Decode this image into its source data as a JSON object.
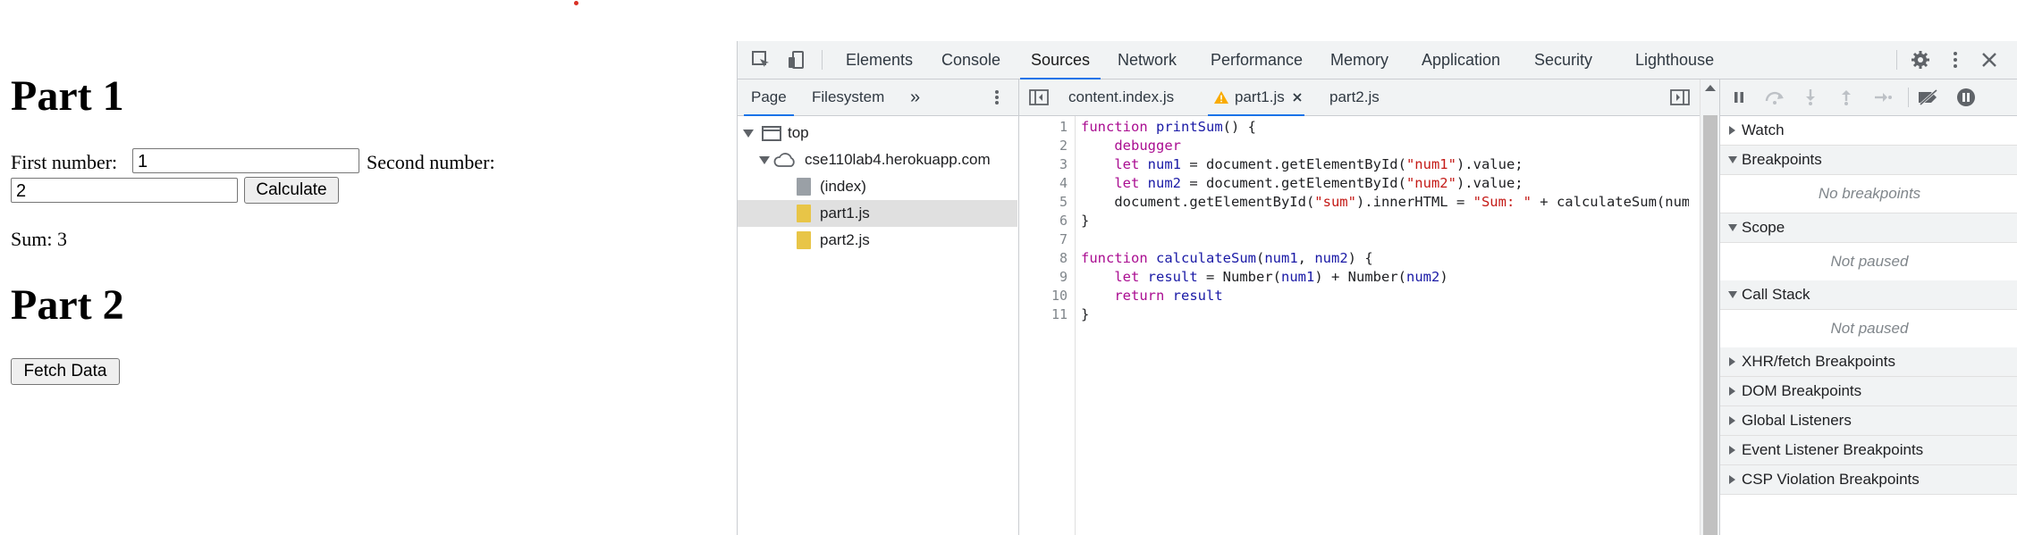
{
  "page": {
    "part1_heading": "Part 1",
    "first_label": "First number:",
    "first_value": "1",
    "second_label": "Second number:",
    "second_value": "2",
    "calculate_label": "Calculate",
    "sum_text": "Sum: 3",
    "part2_heading": "Part 2",
    "fetch_label": "Fetch Data"
  },
  "devtools": {
    "tabs": [
      "Elements",
      "Console",
      "Sources",
      "Network",
      "Performance",
      "Memory",
      "Application",
      "Security",
      "Lighthouse"
    ],
    "active_tab": "Sources",
    "navigator": {
      "tabs": [
        "Page",
        "Filesystem"
      ],
      "more": "»",
      "tree": {
        "top": "top",
        "domain": "cse110lab4.herokuapp.com",
        "files": [
          "(index)",
          "part1.js",
          "part2.js"
        ],
        "selected": "part1.js"
      }
    },
    "editor": {
      "tabs": [
        "content.index.js",
        "part1.js",
        "part2.js"
      ],
      "active_tab": "part1.js",
      "line_numbers": [
        "1",
        "2",
        "3",
        "4",
        "5",
        "6",
        "7",
        "8",
        "9",
        "10",
        "11"
      ]
    },
    "sidebar": {
      "sections": [
        {
          "name": "Watch",
          "expanded": false
        },
        {
          "name": "Breakpoints",
          "expanded": true,
          "message": "No breakpoints"
        },
        {
          "name": "Scope",
          "expanded": true,
          "message": "Not paused"
        },
        {
          "name": "Call Stack",
          "expanded": true,
          "message": "Not paused"
        },
        {
          "name": "XHR/fetch Breakpoints",
          "expanded": false
        },
        {
          "name": "DOM Breakpoints",
          "expanded": false
        },
        {
          "name": "Global Listeners",
          "expanded": false
        },
        {
          "name": "Event Listener Breakpoints",
          "expanded": false
        },
        {
          "name": "CSP Violation Breakpoints",
          "expanded": false
        }
      ]
    },
    "colors": {
      "accent": "#1a73e8",
      "keyword": "#aa0d91",
      "string": "#c41a16",
      "warning": "#f9ab00"
    }
  }
}
